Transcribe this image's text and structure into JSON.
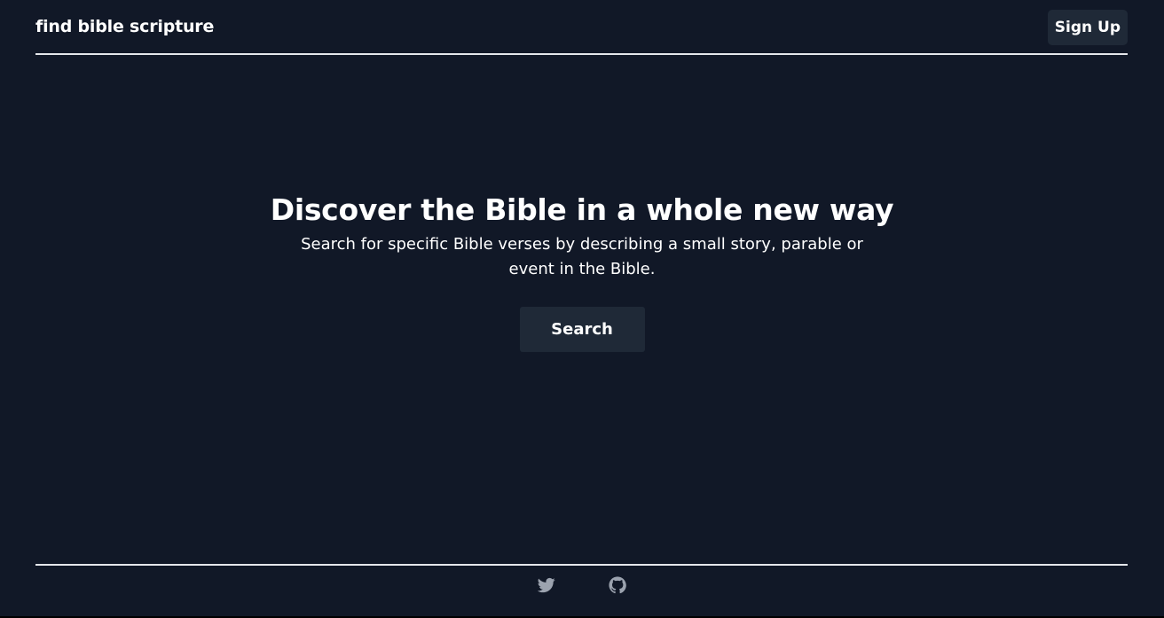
{
  "header": {
    "brand": "find bible scripture",
    "signup_label": "Sign Up"
  },
  "hero": {
    "title": "Discover the Bible in a whole new way",
    "subtitle": "Search for specific Bible verses by describing a small story, parable or event in the Bible.",
    "search_label": "Search"
  },
  "footer": {
    "icons": [
      "twitter-icon",
      "github-icon"
    ]
  },
  "colors": {
    "background": "#111827",
    "button": "#1f2937",
    "divider": "#e5e7eb",
    "icon": "#9ca3af"
  }
}
